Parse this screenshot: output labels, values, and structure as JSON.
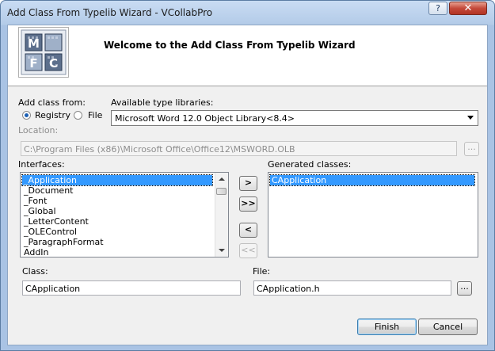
{
  "window": {
    "title": "Add Class From Typelib Wizard - VCollabPro",
    "help_label": "?",
    "close_label": "✕"
  },
  "header": {
    "welcome": "Welcome to the Add Class From Typelib Wizard",
    "logo_letters": [
      "M",
      "F",
      "C"
    ]
  },
  "source": {
    "label": "Add class from:",
    "registry_label": "Registry",
    "file_label": "File",
    "selected": "Registry"
  },
  "typelib": {
    "label": "Available type libraries:",
    "value": "Microsoft Word 12.0 Object Library<8.4>"
  },
  "location": {
    "label": "Location:",
    "value": "C:\\Program Files (x86)\\Microsoft Office\\Office12\\MSWORD.OLB",
    "browse_label": "..."
  },
  "interfaces": {
    "label": "Interfaces:",
    "items": [
      "_Application",
      "_Document",
      "_Font",
      "_Global",
      "_LetterContent",
      "_OLEControl",
      "_ParagraphFormat",
      "AddIn"
    ],
    "selected": "_Application"
  },
  "transfer_buttons": {
    "add_one": ">",
    "add_all": ">>",
    "remove_one": "<",
    "remove_all": "<<"
  },
  "generated": {
    "label": "Generated classes:",
    "items": [
      "CApplication"
    ],
    "selected": "CApplication"
  },
  "class_field": {
    "label": "Class:",
    "value": "CApplication"
  },
  "file_field": {
    "label": "File:",
    "value": "CApplication.h",
    "browse_label": "..."
  },
  "footer": {
    "finish_label": "Finish",
    "cancel_label": "Cancel"
  },
  "colors": {
    "selection": "#3399ff",
    "title_bar": "#b3cbe8",
    "close_button": "#c4493a"
  }
}
